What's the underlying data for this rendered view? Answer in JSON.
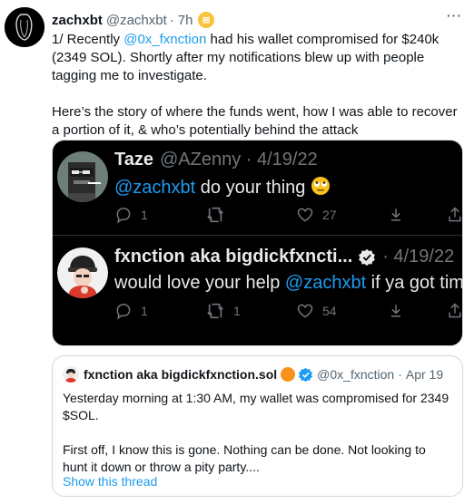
{
  "author": {
    "display_name": "zachxbt",
    "handle": "@zachxbt",
    "separator": "·",
    "time": "7h"
  },
  "more_label": "···",
  "body": {
    "line1_prefix": "1/ Recently ",
    "line1_mention": "@0x_fxnction",
    "line1_suffix": " had his wallet compromised for $240k (2349 SOL). Shortly after my notifications blew up with people tagging me to investigate.",
    "line2": "Here’s the story of where the funds went, how I was able to recover a portion of it, & who’s potentially behind the attack"
  },
  "embedded": {
    "tweet1": {
      "name": "Taze",
      "meta": "@AZenny · 4/19/22",
      "mention": "@zachxbt",
      "text": " do your thing ",
      "reply_count": "1",
      "retweet_count": "",
      "like_count": "27"
    },
    "tweet2": {
      "name": "fxnction aka bigdickfxncti...",
      "meta": "· 4/19/22",
      "text_prefix": "would love your help ",
      "mention": "@zachxbt",
      "text_suffix": " if ya got time.",
      "reply_count": "1",
      "retweet_count": "1",
      "like_count": "54"
    }
  },
  "quote": {
    "name": "fxnction aka bigdickfxnction.sol",
    "handle": "@0x_fxnction",
    "separator": "·",
    "date": "Apr 19",
    "para1": "Yesterday morning at 1:30 AM, my wallet was compromised for 2349 $SOL.",
    "para2": "First off, I know this is gone. Nothing can be done. Not looking to hunt it down or throw a pity party....",
    "show_thread": "Show this thread"
  },
  "colors": {
    "accent": "#1d9bf0",
    "text": "#0f1419",
    "muted": "#536471",
    "dark_bg": "#000000"
  }
}
